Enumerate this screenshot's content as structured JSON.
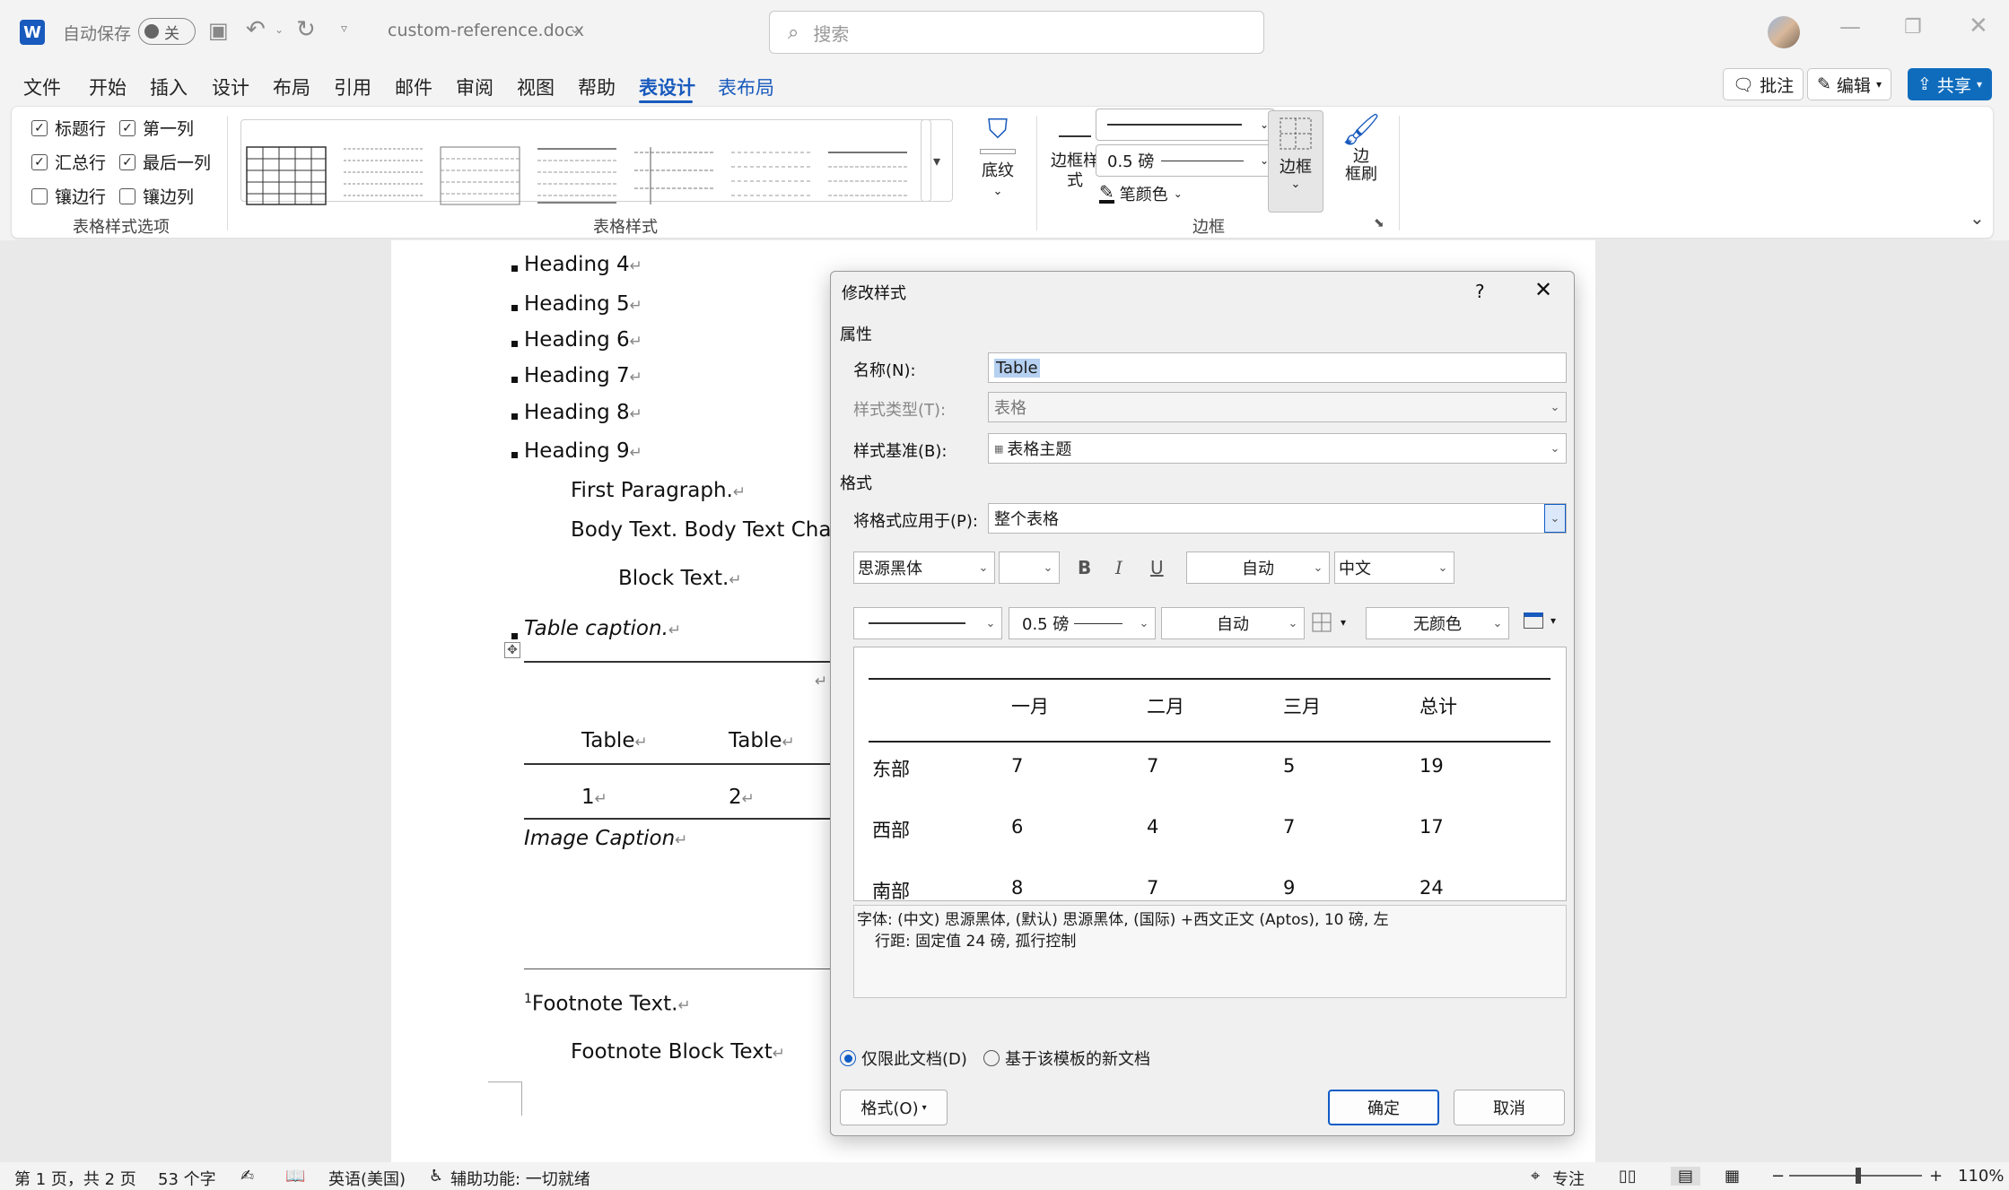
{
  "titlebar": {
    "autosave_label": "自动保存",
    "autosave_state": "关",
    "filename": "custom-reference.docx",
    "search_placeholder": "搜索"
  },
  "menu": {
    "items": [
      "文件",
      "开始",
      "插入",
      "设计",
      "布局",
      "引用",
      "邮件",
      "审阅",
      "视图",
      "帮助",
      "表设计",
      "表布局"
    ],
    "active": "表设计",
    "comment_btn": "批注",
    "edit_btn": "编辑",
    "share_btn": "共享"
  },
  "ribbon": {
    "options": {
      "header_row": "标题行",
      "first_col": "第一列",
      "total_row": "汇总行",
      "last_col": "最后一列",
      "banded_rows": "镶边行",
      "banded_cols": "镶边列",
      "group_label": "表格样式选项"
    },
    "styles_label": "表格样式",
    "shading": "底纹",
    "border_styles": "边框样\n式",
    "weight": "0.5 磅",
    "pen_color": "笔颜色",
    "borders": "边框",
    "border_painter": "边\n框刷",
    "border_group": "边框"
  },
  "document": {
    "headings": [
      "Heading 4",
      "Heading 5",
      "Heading 6",
      "Heading 7",
      "Heading 8",
      "Heading 9"
    ],
    "first_paragraph": "First Paragraph.",
    "body_text": "Body Text. Body Text Char.",
    "block_text": "Block Text.",
    "table_caption": "Table caption.",
    "table_headers": [
      "Table",
      "Table"
    ],
    "table_values": [
      "1",
      "2"
    ],
    "image_caption": "Image Caption",
    "footnote_mark": "1",
    "footnote_text": "Footnote Text.",
    "footnote_block": "Footnote Block Text"
  },
  "dialog": {
    "title": "修改样式",
    "help": "?",
    "properties_label": "属性",
    "name_label": "名称(N):",
    "name_value": "Table",
    "type_label": "样式类型(T):",
    "type_value": "表格",
    "based_label": "样式基准(B):",
    "based_value": "表格主题",
    "format_label": "格式",
    "apply_label": "将格式应用于(P):",
    "apply_value": "整个表格",
    "font_value": "思源黑体",
    "size_value": "",
    "bold": "B",
    "italic": "I",
    "underline": "U",
    "color_value": "自动",
    "script_value": "中文",
    "border_weight": "0.5 磅",
    "border_color": "自动",
    "shade_value": "无颜色",
    "preview": {
      "headers": [
        "",
        "一月",
        "二月",
        "三月",
        "总计"
      ],
      "rows": [
        [
          "东部",
          "7",
          "7",
          "5",
          "19"
        ],
        [
          "西部",
          "6",
          "4",
          "7",
          "17"
        ],
        [
          "南部",
          "8",
          "7",
          "9",
          "24"
        ]
      ]
    },
    "description_line1": "字体: (中文) 思源黑体, (默认) 思源黑体, (国际) +西文正文 (Aptos), 10 磅, 左",
    "description_line2": "行距: 固定值 24 磅, 孤行控制",
    "radio_doc": "仅限此文档(D)",
    "radio_template": "基于该模板的新文档",
    "format_btn": "格式(O)",
    "ok": "确定",
    "cancel": "取消"
  },
  "status": {
    "page": "第 1 页，共 2 页",
    "words": "53 个字",
    "language": "英语(美国)",
    "accessibility": "辅助功能: 一切就绪",
    "focus": "专注",
    "zoom": "110%"
  },
  "colors": {
    "accent": "#185abd",
    "share_bg": "#0f6cbd"
  }
}
